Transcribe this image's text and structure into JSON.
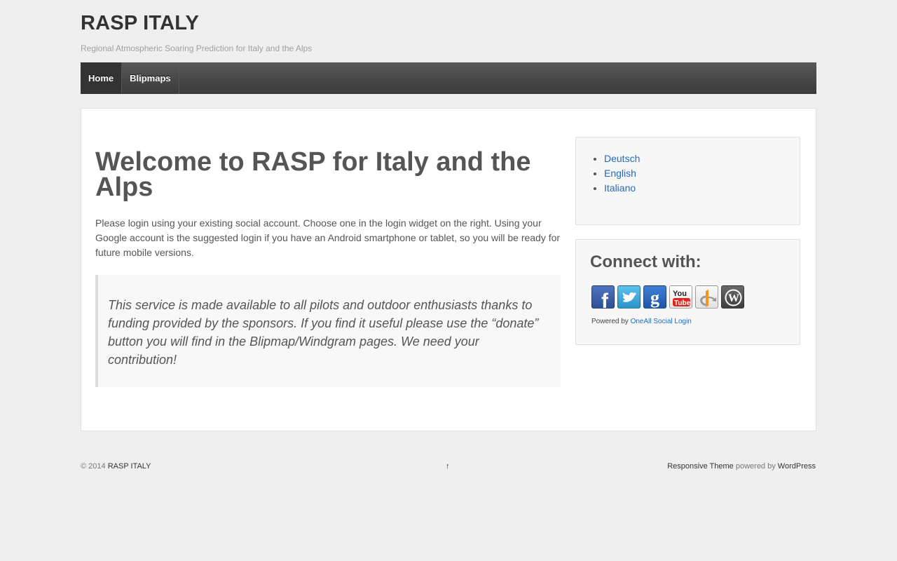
{
  "site": {
    "title": "RASP ITALY",
    "description": "Regional Atmospheric Soaring Prediction for Italy and the Alps"
  },
  "nav": {
    "items": [
      {
        "label": "Home",
        "active": true
      },
      {
        "label": "Blipmaps",
        "active": false
      }
    ]
  },
  "main": {
    "title": "Welcome to RASP for Italy and the Alps",
    "intro": "Please login using your existing social account. Choose one in the login widget on the right. Using your Google account is the suggested login if you have an Android smartphone or tablet, so you will be ready for future mobile versions.",
    "quote": "This service is made available to all pilots and outdoor enthusiasts thanks to funding provided by the sponsors. If you find it useful please use the “donate” button you will find in the Blipmap/Windgram pages. We need your contribution!"
  },
  "sidebar": {
    "languages": [
      "Deutsch",
      "English",
      "Italiano"
    ],
    "social": {
      "heading": "Connect with:",
      "icons": [
        "facebook-icon",
        "twitter-icon",
        "google-icon",
        "youtube-icon",
        "openid-icon",
        "wordpress-icon"
      ],
      "powered_prefix": "Powered by",
      "powered_link": "OneAll Social Login"
    }
  },
  "footer": {
    "copyright_prefix": "© 2014",
    "site_link": "RASP ITALY",
    "back_to_top": "↑",
    "theme_link": "Responsive Theme",
    "powered_by": "powered by",
    "wp_link": "WordPress"
  },
  "colors": {
    "background": "#efefef",
    "link": "#1e6bc5",
    "nav": "#3a3a3a"
  }
}
